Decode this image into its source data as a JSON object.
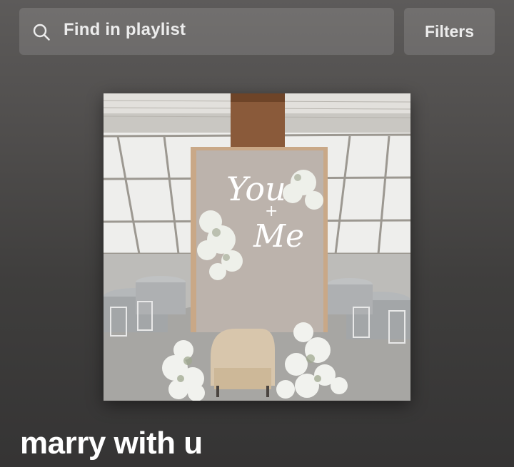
{
  "search": {
    "label": "Find in playlist",
    "icon": "search-icon"
  },
  "filters": {
    "label": "Filters"
  },
  "cover": {
    "sign_line_1": "You",
    "sign_line_2": "+",
    "sign_line_3": "Me"
  },
  "playlist": {
    "title": "marry with u"
  },
  "colors": {
    "background_top": "#5d5b5a",
    "background_bottom": "#353434",
    "control_bg": "#797776",
    "text": "#ffffff"
  }
}
